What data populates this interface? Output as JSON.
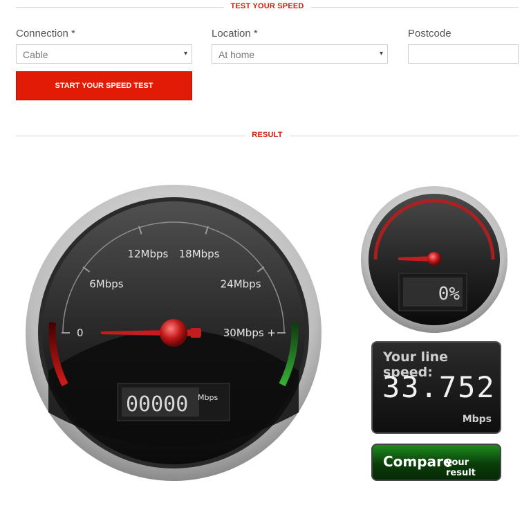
{
  "sections": {
    "test_title": "TEST YOUR SPEED",
    "result_title": "RESULT"
  },
  "form": {
    "connection_label": "Connection *",
    "connection_value": "Cable",
    "location_label": "Location *",
    "location_value": "At home",
    "postcode_label": "Postcode",
    "postcode_value": "",
    "start_button": "START YOUR SPEED TEST"
  },
  "main_gauge": {
    "tick_labels": [
      "0",
      "6Mbps",
      "12Mbps",
      "18Mbps",
      "24Mbps",
      "30Mbps +"
    ],
    "needle_value_mbps": 0,
    "readout": "00000",
    "readout_unit": "Mbps"
  },
  "small_gauge": {
    "percent_readout": "0%",
    "needle_fraction": 0
  },
  "line_speed": {
    "title": "Your line speed:",
    "value": "33.752",
    "unit": "Mbps"
  },
  "compare": {
    "main_label": "Compare",
    "sub_label": "your result"
  },
  "colors": {
    "accent_red": "#e21b06",
    "title_red": "#d61a0f",
    "gauge_green": "#2fa12f",
    "compare_green": "#1f8b1f"
  },
  "icons": {
    "select_caret": "▾"
  }
}
